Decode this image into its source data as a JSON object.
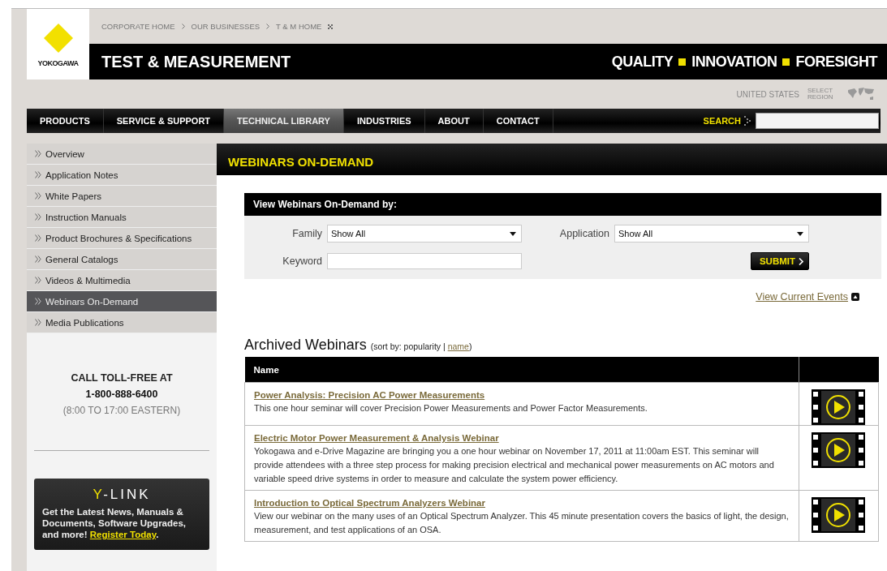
{
  "header": {
    "breadcrumbs": [
      "CORPORATE HOME",
      "OUR BUSINESSES",
      "T & M HOME"
    ],
    "logo_text": "YOKOGAWA",
    "title": "TEST & MEASUREMENT",
    "tagline": [
      "QUALITY",
      "INNOVATION",
      "FORESIGHT"
    ],
    "region": {
      "country": "UNITED STATES",
      "select_label": "SELECT REGION"
    }
  },
  "nav": {
    "items": [
      {
        "label": "PRODUCTS",
        "selected": false
      },
      {
        "label": "SERVICE & SUPPORT",
        "selected": false
      },
      {
        "label": "TECHNICAL LIBRARY",
        "selected": true
      },
      {
        "label": "INDUSTRIES",
        "selected": false
      },
      {
        "label": "ABOUT",
        "selected": false
      },
      {
        "label": "CONTACT",
        "selected": false
      }
    ],
    "search_label": "SEARCH"
  },
  "sidebar": {
    "items": [
      {
        "label": "Overview",
        "selected": false
      },
      {
        "label": "Application Notes",
        "selected": false
      },
      {
        "label": "White Papers",
        "selected": false
      },
      {
        "label": "Instruction Manuals",
        "selected": false
      },
      {
        "label": "Product Brochures & Specifications",
        "selected": false
      },
      {
        "label": "General Catalogs",
        "selected": false
      },
      {
        "label": "Videos & Multimedia",
        "selected": false
      },
      {
        "label": "Webinars On-Demand",
        "selected": true
      },
      {
        "label": "Media Publications",
        "selected": false
      }
    ],
    "contact": {
      "heading": "CALL TOLL-FREE AT",
      "phone": "1-800-888-6400",
      "hours": "(8:00 TO 17:00 EASTERN)"
    },
    "ylink": {
      "title_accent": "Y",
      "title_rest": "-LINK",
      "text": "Get the Latest News, Manuals & Documents, Software Upgrades, and more!",
      "link": "Register Today",
      "end": "."
    }
  },
  "main": {
    "title": "WEBINARS ON-DEMAND",
    "filter": {
      "heading": "View Webinars On-Demand by:",
      "family": {
        "label": "Family",
        "value": "Show All"
      },
      "application": {
        "label": "Application",
        "value": "Show All"
      },
      "keyword": {
        "label": "Keyword"
      },
      "submit": "SUBMIT"
    },
    "current_events_link": "View Current Events",
    "archive": {
      "title": "Archived Webinars",
      "sort_prefix": "(sort by: popularity |",
      "sort_link": "name",
      "sort_suffix": ")"
    },
    "table": {
      "columns": [
        "Name"
      ],
      "rows": [
        {
          "title": "Power Analysis: Precision AC Power Measurements",
          "description": "This one hour seminar will cover Precision Power Measurements and Power Factor Measurements."
        },
        {
          "title": "Electric Motor Power Measurement & Analysis Webinar",
          "description": "Yokogawa and e-Drive Magazine are bringing you a one hour webinar on November 17, 2011 at 11:00am EST. This seminar will provide attendees with a three step process for making precision electrical and mechanical power measurements on AC motors and variable speed drive systems in order to measure and calculate the system power efficiency."
        },
        {
          "title": "Introduction to Optical Spectrum Analyzers Webinar",
          "description": "View our webinar on the many uses of an Optical Spectrum Analyzer. This 45 minute presentation covers the basics of light, the design, measurement, and test applications of an OSA."
        }
      ]
    }
  }
}
